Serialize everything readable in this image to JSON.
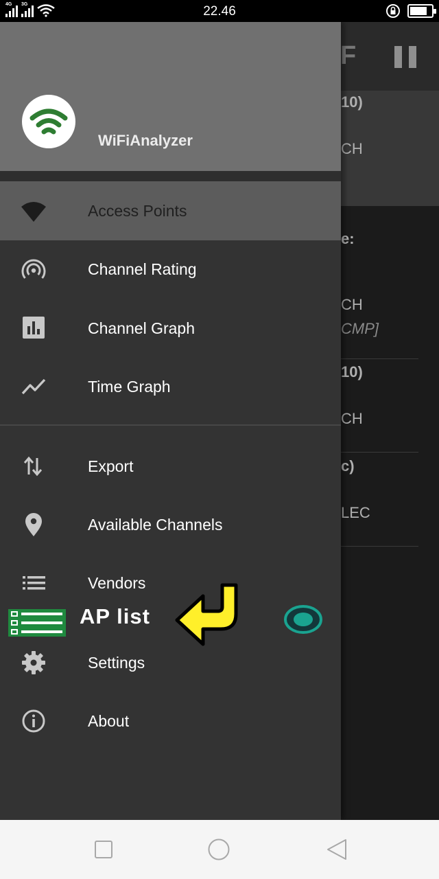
{
  "status_bar": {
    "time": "22.46",
    "network_1": "4G",
    "network_2": "3G",
    "battery_level": 0.8,
    "icons": [
      "signal-icon",
      "wifi-icon",
      "lock-rotation-icon",
      "battery-icon"
    ]
  },
  "background_app": {
    "lines": [
      {
        "text": "10)",
        "bold": true
      },
      {
        "text": "CH",
        "bold": false
      },
      {
        "text": "e:",
        "bold": true
      },
      {
        "text": "CH",
        "bold": false
      },
      {
        "text": "CMP]",
        "italic": true
      },
      {
        "text": "10)",
        "bold": true
      },
      {
        "text": "CH",
        "bold": false
      },
      {
        "text": "c)",
        "bold": true
      },
      {
        "text": "LEC",
        "bold": false
      }
    ]
  },
  "drawer": {
    "app_name": "WiFiAnalyzer",
    "items": [
      {
        "label": "Access Points",
        "icon": "wifi-icon",
        "active": true
      },
      {
        "label": "Channel Rating",
        "icon": "wifi-tethering-icon",
        "active": false
      },
      {
        "label": "Channel Graph",
        "icon": "bar-chart-icon",
        "active": false
      },
      {
        "label": "Time Graph",
        "icon": "line-chart-icon",
        "active": false
      },
      {
        "label": "Export",
        "icon": "import-export-icon",
        "active": false
      },
      {
        "label": "Available Channels",
        "icon": "location-pin-icon",
        "active": false
      },
      {
        "label": "Vendors",
        "icon": "list-icon",
        "active": false
      },
      {
        "label": "Settings",
        "icon": "gear-icon",
        "active": false
      },
      {
        "label": "About",
        "icon": "info-icon",
        "active": false
      }
    ]
  },
  "overlay": {
    "label": "AP list",
    "icons": [
      "ap-list-icon",
      "arrow-icon",
      "toggle-icon"
    ],
    "colors": {
      "accent_green": "#1f8a3f",
      "arrow_yellow": "#ffef2a",
      "toggle_teal": "#1aa390"
    }
  },
  "nav_bar": {
    "buttons": [
      "recent-apps-button",
      "home-button",
      "back-button"
    ]
  }
}
